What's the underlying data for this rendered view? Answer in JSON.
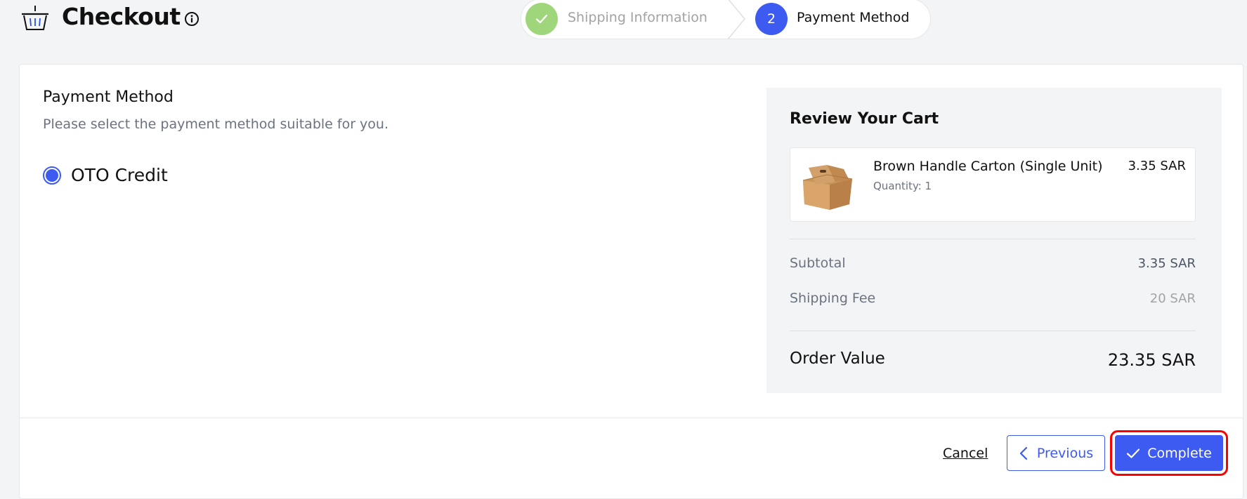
{
  "header": {
    "title": "Checkout"
  },
  "stepper": {
    "steps": [
      {
        "label": "Shipping Information",
        "state": "completed"
      },
      {
        "number": "2",
        "label": "Payment Method",
        "state": "active"
      }
    ]
  },
  "payment": {
    "title": "Payment Method",
    "subtitle": "Please select the payment method suitable for you.",
    "options": [
      {
        "label": "OTO Credit",
        "selected": true
      }
    ]
  },
  "cart": {
    "title": "Review Your Cart",
    "items": [
      {
        "name": "Brown Handle Carton (Single Unit)",
        "quantity": "Quantity: 1",
        "price": "3.35 SAR"
      }
    ],
    "subtotal_label": "Subtotal",
    "subtotal_value": "3.35 SAR",
    "shipping_label": "Shipping Fee",
    "shipping_value": "20 SAR",
    "total_label": "Order Value",
    "total_value": "23.35 SAR"
  },
  "footer": {
    "cancel_label": "Cancel",
    "previous_label": "Previous",
    "complete_label": "Complete"
  },
  "colors": {
    "accent": "#3d5af1",
    "completed_step": "#9fd67c",
    "highlight": "#ff0000"
  },
  "icons": [
    "basket-icon",
    "info-icon",
    "check-icon",
    "chevron-left-icon",
    "product-image"
  ]
}
